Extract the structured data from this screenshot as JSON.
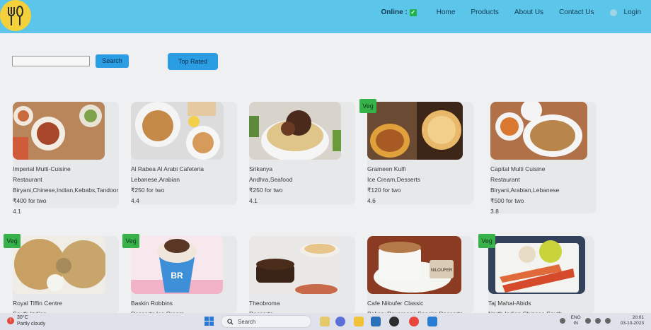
{
  "header": {
    "online_label": "Online :",
    "nav": [
      "Home",
      "Products",
      "About Us",
      "Contact Us"
    ],
    "login_label": "Login"
  },
  "search": {
    "button_label": "Search",
    "top_rated_label": "Top Rated"
  },
  "veg_label": "Veg",
  "cards": [
    {
      "veg": false,
      "lines": [
        "Imperial Multi-Cuisine",
        "Restaurant",
        "Biryani,Chinese,Indian,Kebabs,Tandoor",
        "₹400 for two",
        "4.1"
      ]
    },
    {
      "veg": false,
      "lines": [
        "Al Rabea Al Arabi Cafeteria",
        "Lebanese,Arabian",
        "₹250 for two",
        "4.4"
      ]
    },
    {
      "veg": false,
      "lines": [
        "Srikanya",
        "Andhra,Seafood",
        "₹250 for two",
        "4.1"
      ]
    },
    {
      "veg": true,
      "lines": [
        "Grameen Kulfi",
        "Ice Cream,Desserts",
        "₹120 for two",
        "4.6"
      ]
    },
    {
      "veg": false,
      "lines": [
        "Capital Multi Cuisine",
        "Restaurant",
        "Biryani,Arabian,Lebanese",
        "₹500 for two",
        "3.8"
      ]
    },
    {
      "veg": true,
      "lines": [
        "Royal Tiffin Centre",
        "South Indian"
      ]
    },
    {
      "veg": true,
      "lines": [
        "Baskin Robbins",
        "Desserts,Ice Cream"
      ]
    },
    {
      "veg": false,
      "lines": [
        "Theobroma",
        "Desserts"
      ]
    },
    {
      "veg": false,
      "lines": [
        "Cafe Niloufer Classic",
        "Bakery,Beverages,Snacks,Desserts"
      ]
    },
    {
      "veg": true,
      "lines": [
        "Taj Mahal-Abids",
        "North Indian,Chinese,South"
      ]
    }
  ],
  "taskbar": {
    "weather_temp": "30°C",
    "weather_desc": "Partly cloudy",
    "search_label": "Search",
    "lang": [
      "ENG",
      "IN"
    ],
    "time": "20:01",
    "date": "03-10-2023"
  },
  "colors": {
    "header": "#5cc5ea",
    "button": "#2b9de3",
    "veg": "#37b24a",
    "logo": "#f4d13a"
  }
}
